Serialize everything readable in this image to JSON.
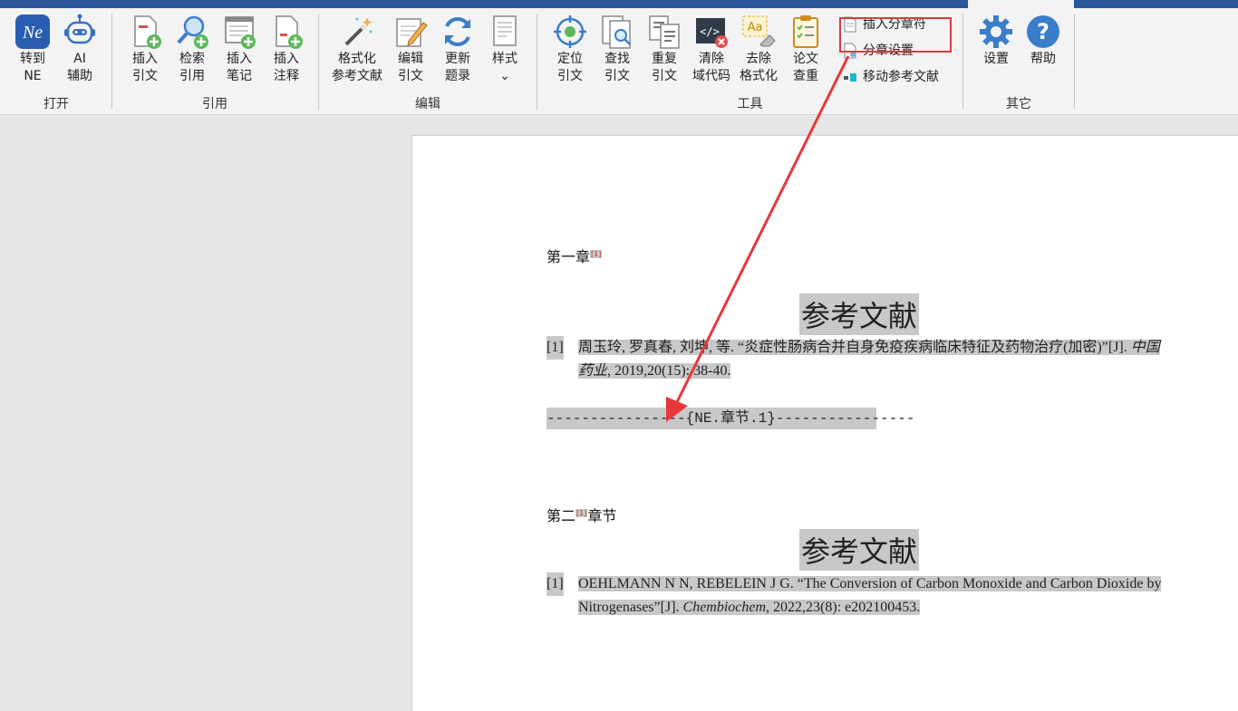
{
  "ribbon": {
    "groups": {
      "open": "打开",
      "cite": "引用",
      "edit": "编辑",
      "tools": "工具",
      "other": "其它"
    },
    "buttons": {
      "goto_ne": "转到\nNE",
      "ai": "AI\n辅助",
      "insert_cite": "插入\n引文",
      "search_cite": "检索\n引用",
      "insert_note": "插入\n笔记",
      "insert_annot": "插入\n注释",
      "format_refs": "格式化\n参考文献",
      "edit_cite": "编辑\n引文",
      "update_items": "更新\n题录",
      "style": "样式\n⌄",
      "locate_cite": "定位\n引文",
      "find_cite": "查找\n引文",
      "dup_cite": "重复\n引文",
      "clear_field": "清除\n域代码",
      "remove_format": "去除\n格式化",
      "plagiarism": "论文\n查重",
      "settings": "设置",
      "help": "帮助"
    },
    "small_buttons": {
      "insert_chapter_break": "插入分章符",
      "chapter_settings": "分章设置",
      "move_refs": "移动参考文献"
    }
  },
  "document": {
    "chapter1": "第一章",
    "cite_mark": "[1]",
    "ref_heading": "参考文献",
    "ref1_num": "[1]",
    "ref1_a": "周玉玲, 罗真春, 刘坤, 等. “炎症性肠病合并自身免疫疾病临床特征及药物治疗(加密)”[J].",
    "ref1_journal": "中国药业",
    "ref1_b": ", 2019,20(15): 38-40.",
    "chapter_marker": "----------------{NE.章节.1}----------------",
    "chapter2_a": "第二",
    "chapter2_b": "章节",
    "ref2_num": "[1]",
    "ref2_a": "OEHLMANN N N, REBELEIN J G. “The Conversion of Carbon Monoxide and Carbon Dioxide by Nitrogenases”[J]. ",
    "ref2_journal": "Chembiochem",
    "ref2_b": ", 2022,23(8): e202100453."
  },
  "colors": {
    "ribbon_bg": "#f3f3f3",
    "title_bar": "#2b579a",
    "highlight_box": "#e0393b",
    "field_shading": "#c8c8c8",
    "arrow": "#e8373a"
  }
}
